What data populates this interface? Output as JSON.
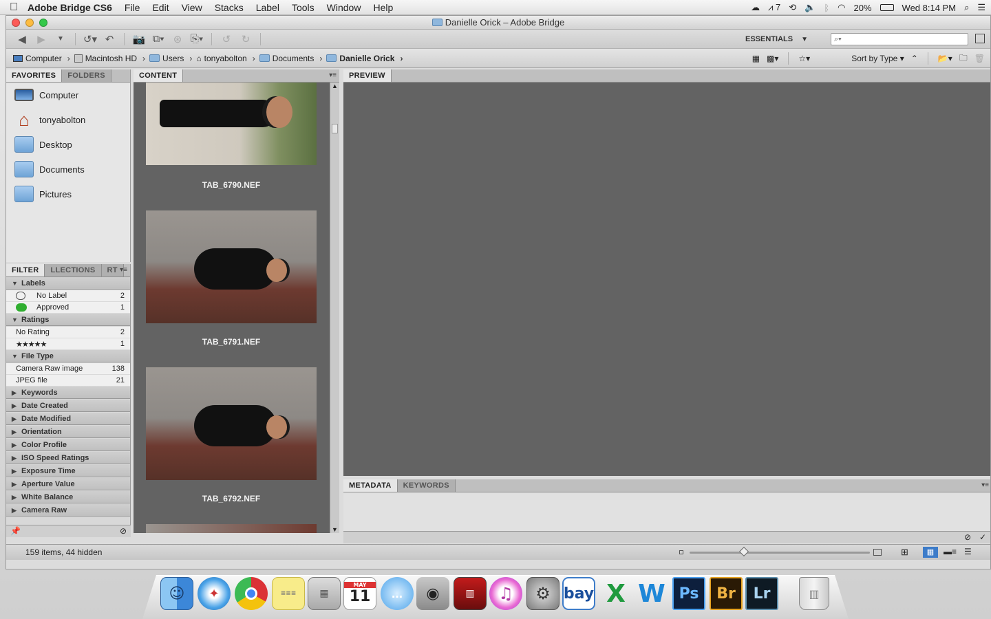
{
  "menubar": {
    "app_name": "Adobe Bridge CS6",
    "items": [
      "File",
      "Edit",
      "View",
      "Stacks",
      "Label",
      "Tools",
      "Window",
      "Help"
    ],
    "status": {
      "adobe_count": "7",
      "battery": "20%",
      "clock": "Wed 8:14 PM"
    }
  },
  "window": {
    "title": "Danielle Orick – Adobe Bridge"
  },
  "toolbar": {
    "workspace_label": "ESSENTIALS",
    "search_placeholder": "⌕▾"
  },
  "pathbar": {
    "crumbs": [
      "Computer",
      "Macintosh HD",
      "Users",
      "tonyabolton",
      "Documents",
      "Danielle Orick"
    ],
    "sort_label": "Sort by Type"
  },
  "favorites_panel": {
    "tabs": [
      "FAVORITES",
      "FOLDERS"
    ],
    "items": [
      "Computer",
      "tonyabolton",
      "Desktop",
      "Documents",
      "Pictures"
    ]
  },
  "filter_panel": {
    "tabs": [
      "FILTER",
      "LLECTIONS",
      "RT"
    ],
    "labels_header": "Labels",
    "labels": [
      {
        "name": "No Label",
        "count": "2"
      },
      {
        "name": "Approved",
        "count": "1"
      }
    ],
    "ratings_header": "Ratings",
    "ratings": [
      {
        "name": "No Rating",
        "count": "2"
      },
      {
        "name": "★★★★★",
        "count": "1"
      }
    ],
    "filetype_header": "File Type",
    "filetypes": [
      {
        "name": "Camera Raw image",
        "count": "138"
      },
      {
        "name": "JPEG file",
        "count": "21"
      }
    ],
    "collapsed": [
      "Keywords",
      "Date Created",
      "Date Modified",
      "Orientation",
      "Color Profile",
      "ISO Speed Ratings",
      "Exposure Time",
      "Aperture Value",
      "White Balance",
      "Camera Raw"
    ]
  },
  "content_panel": {
    "tab": "CONTENT",
    "thumbnails": [
      "TAB_6790.NEF",
      "TAB_6791.NEF",
      "TAB_6792.NEF"
    ]
  },
  "preview_panel": {
    "tab": "PREVIEW"
  },
  "metadata_panel": {
    "tabs": [
      "METADATA",
      "KEYWORDS"
    ]
  },
  "status": {
    "items_text": "159 items, 44 hidden",
    "thumbnail_size": 0.3
  },
  "dock": {
    "apps": [
      "finder-icon",
      "safari-icon",
      "chrome-icon",
      "stickies-icon",
      "calculator-icon",
      "calendar-icon",
      "messages-icon",
      "facetime-icon",
      "photobooth-icon",
      "itunes-icon",
      "system-preferences-icon",
      "ebay-icon",
      "excel-icon",
      "word-icon",
      "photoshop-icon",
      "bridge-icon",
      "lightroom-icon",
      "trash-icon"
    ],
    "calendar_month": "MAY",
    "calendar_day": "11",
    "labels": {
      "ebay": "bay",
      "excel": "X",
      "word": "W",
      "photoshop": "Ps",
      "bridge": "Br",
      "lightroom": "Lr"
    }
  },
  "colors": {
    "accent": "#3d7cc9",
    "panel_dark": "#636363",
    "approved_green": "#2fae2f"
  }
}
